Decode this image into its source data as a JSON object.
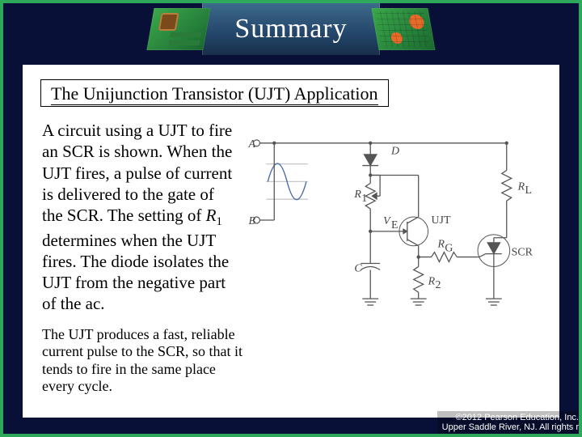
{
  "banner": {
    "title": "Summary"
  },
  "section": {
    "title": "The Unijunction Transistor (UJT) Application"
  },
  "body": {
    "para1_a": "A circuit using a UJT to fire an SCR is shown. When the UJT fires, a pulse of current is delivered to the gate of the SCR. The setting of ",
    "para1_r": "R",
    "para1_sub": "1",
    "para1_b": " determines when the UJT fires. The diode isolates the UJT from the negative part of the ac."
  },
  "body2": {
    "para": "The UJT produces a fast, reliable current pulse to the SCR, so that it tends to fire in the same place every cycle."
  },
  "circuit": {
    "labels": {
      "A": "A",
      "B": "B",
      "D": "D",
      "R1": "R",
      "R1s": "1",
      "VE": "V",
      "VEs": "E",
      "UJT": "UJT",
      "RG": "R",
      "RGs": "G",
      "SCR": "SCR",
      "C": "C",
      "R2": "R",
      "R2s": "2",
      "RL": "R",
      "RLs": "L"
    }
  },
  "copyright": {
    "line1": "©2012 Pearson Education, Inc.",
    "line2": "Upper Saddle River, NJ. All rights r"
  }
}
